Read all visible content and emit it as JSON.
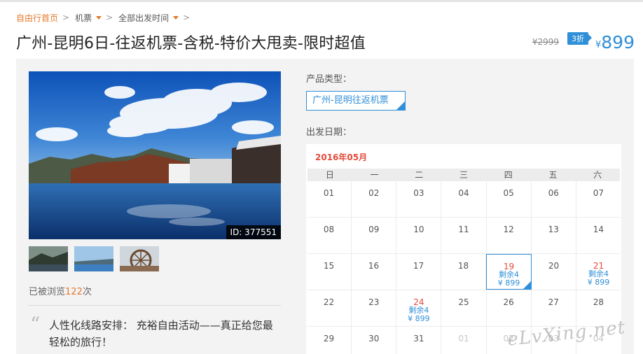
{
  "breadcrumb": {
    "home": "自由行首页",
    "category": "机票",
    "departure": "全部出发时间",
    "separator": ">"
  },
  "title": "广州-昆明6日-往返机票-含税-特价大甩卖-限时超值",
  "price": {
    "original": "¥2999",
    "discount": "3折",
    "currency": "¥",
    "current": "899"
  },
  "gallery": {
    "photo_id": "ID: 377551",
    "thumbnails": [
      "lake-mountain-thumb",
      "lake-shore-thumb",
      "waterwheel-thumb"
    ]
  },
  "stats": {
    "views_prefix": "已被浏览",
    "views_count": "122",
    "views_suffix": "次"
  },
  "highlight": {
    "quote": "“",
    "text": "人性化线路安排： 充裕自由活动——真正给您最轻松的旅行！"
  },
  "product": {
    "type_label": "产品类型：",
    "type_value": "广州-昆明往返机票",
    "date_label": "出发日期："
  },
  "calendar": {
    "month": "2016年05月",
    "weekdays": [
      "日",
      "一",
      "二",
      "三",
      "四",
      "五",
      "六"
    ],
    "rows": [
      [
        {
          "d": "01"
        },
        {
          "d": "02"
        },
        {
          "d": "03"
        },
        {
          "d": "04"
        },
        {
          "d": "05"
        },
        {
          "d": "06"
        },
        {
          "d": "07"
        }
      ],
      [
        {
          "d": "08"
        },
        {
          "d": "09"
        },
        {
          "d": "10"
        },
        {
          "d": "11"
        },
        {
          "d": "12"
        },
        {
          "d": "13"
        },
        {
          "d": "14"
        }
      ],
      [
        {
          "d": "15"
        },
        {
          "d": "16"
        },
        {
          "d": "17"
        },
        {
          "d": "18"
        },
        {
          "d": "19",
          "stock": "剩余4",
          "price": "¥ 899",
          "selected": true
        },
        {
          "d": "20"
        },
        {
          "d": "21",
          "stock": "剩余4",
          "price": "¥ 899"
        }
      ],
      [
        {
          "d": "22"
        },
        {
          "d": "23"
        },
        {
          "d": "24",
          "stock": "剩余4",
          "price": "¥ 899"
        },
        {
          "d": "25"
        },
        {
          "d": "26"
        },
        {
          "d": "27"
        },
        {
          "d": "28"
        }
      ],
      [
        {
          "d": "29"
        },
        {
          "d": "30"
        },
        {
          "d": "31"
        },
        {
          "d": "01",
          "muted": true
        },
        {
          "d": "02",
          "muted": true
        },
        {
          "d": "03",
          "muted": true
        },
        {
          "d": "04",
          "muted": true
        }
      ]
    ]
  },
  "watermark": "eLvXing.net",
  "colors": {
    "accent_blue": "#2f8fd8",
    "accent_orange": "#e4792b",
    "date_red": "#e34a3b"
  }
}
